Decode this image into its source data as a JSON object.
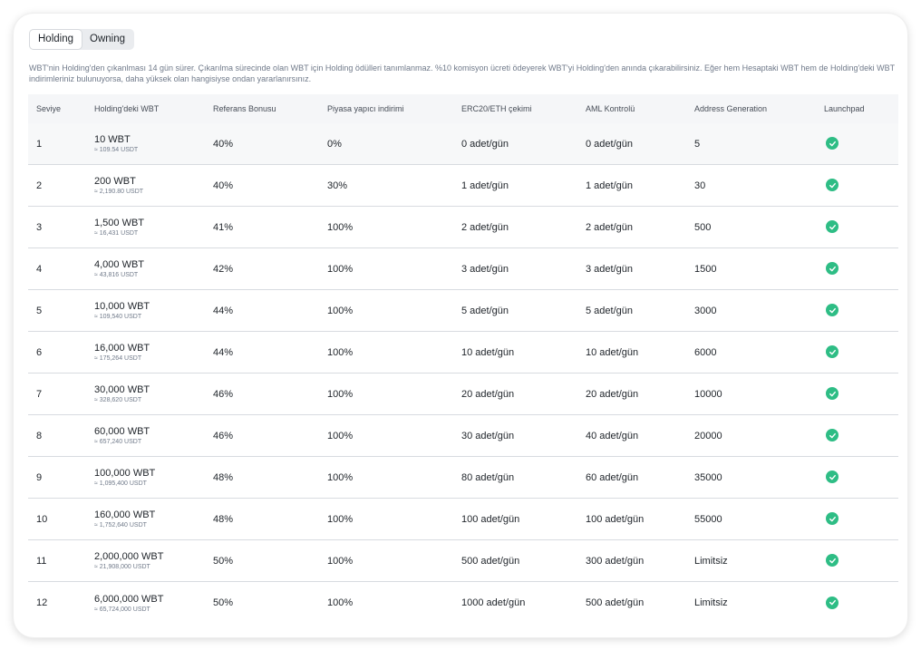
{
  "tabs": [
    {
      "label": "Holding",
      "active": true
    },
    {
      "label": "Owning",
      "active": false
    }
  ],
  "description": "WBT'nin Holding'den çıkanlması 14 gün sürer. Çıkarılma sürecinde olan WBT için Holding ödülleri tanımlanmaz. %10 komisyon ücreti ödeyerek WBT'yi Holding'den anında çıkarabilirsiniz. Eğer hem Hesaptaki WBT hem de Holding'deki WBT indirimleriniz bulunuyorsa, daha yüksek olan hangisiyse ondan yararlanırsınız.",
  "colors": {
    "accent_green": "#2ebd85"
  },
  "table": {
    "headers": [
      "Seviye",
      "Holding'deki WBT",
      "Referans Bonusu",
      "Piyasa yapıcı indirimi",
      "ERC20/ETH çekimi",
      "AML Kontrolü",
      "Address Generation",
      "Launchpad"
    ],
    "launchpad_icon": "check-circle-icon",
    "rows": [
      {
        "level": "1",
        "wbt": "10 WBT",
        "usdt": "≈ 109.54 USDT",
        "referral": "40%",
        "maker": "0%",
        "erc20": "0 adet/gün",
        "aml": "0 adet/gün",
        "address": "5",
        "launchpad": true
      },
      {
        "level": "2",
        "wbt": "200 WBT",
        "usdt": "≈ 2,190.80 USDT",
        "referral": "40%",
        "maker": "30%",
        "erc20": "1 adet/gün",
        "aml": "1 adet/gün",
        "address": "30",
        "launchpad": true
      },
      {
        "level": "3",
        "wbt": "1,500 WBT",
        "usdt": "≈ 16,431 USDT",
        "referral": "41%",
        "maker": "100%",
        "erc20": "2 adet/gün",
        "aml": "2 adet/gün",
        "address": "500",
        "launchpad": true
      },
      {
        "level": "4",
        "wbt": "4,000 WBT",
        "usdt": "≈ 43,816 USDT",
        "referral": "42%",
        "maker": "100%",
        "erc20": "3 adet/gün",
        "aml": "3 adet/gün",
        "address": "1500",
        "launchpad": true
      },
      {
        "level": "5",
        "wbt": "10,000 WBT",
        "usdt": "≈ 109,540 USDT",
        "referral": "44%",
        "maker": "100%",
        "erc20": "5 adet/gün",
        "aml": "5 adet/gün",
        "address": "3000",
        "launchpad": true
      },
      {
        "level": "6",
        "wbt": "16,000 WBT",
        "usdt": "≈ 175,264 USDT",
        "referral": "44%",
        "maker": "100%",
        "erc20": "10 adet/gün",
        "aml": "10 adet/gün",
        "address": "6000",
        "launchpad": true
      },
      {
        "level": "7",
        "wbt": "30,000 WBT",
        "usdt": "≈ 328,620 USDT",
        "referral": "46%",
        "maker": "100%",
        "erc20": "20 adet/gün",
        "aml": "20 adet/gün",
        "address": "10000",
        "launchpad": true
      },
      {
        "level": "8",
        "wbt": "60,000 WBT",
        "usdt": "≈ 657,240 USDT",
        "referral": "46%",
        "maker": "100%",
        "erc20": "30 adet/gün",
        "aml": "40 adet/gün",
        "address": "20000",
        "launchpad": true
      },
      {
        "level": "9",
        "wbt": "100,000 WBT",
        "usdt": "≈ 1,095,400 USDT",
        "referral": "48%",
        "maker": "100%",
        "erc20": "80 adet/gün",
        "aml": "60 adet/gün",
        "address": "35000",
        "launchpad": true
      },
      {
        "level": "10",
        "wbt": "160,000 WBT",
        "usdt": "≈ 1,752,640 USDT",
        "referral": "48%",
        "maker": "100%",
        "erc20": "100 adet/gün",
        "aml": "100 adet/gün",
        "address": "55000",
        "launchpad": true
      },
      {
        "level": "11",
        "wbt": "2,000,000 WBT",
        "usdt": "≈ 21,908,000 USDT",
        "referral": "50%",
        "maker": "100%",
        "erc20": "500 adet/gün",
        "aml": "300 adet/gün",
        "address": "Limitsiz",
        "launchpad": true
      },
      {
        "level": "12",
        "wbt": "6,000,000 WBT",
        "usdt": "≈ 65,724,000 USDT",
        "referral": "50%",
        "maker": "100%",
        "erc20": "1000 adet/gün",
        "aml": "500 adet/gün",
        "address": "Limitsiz",
        "launchpad": true
      }
    ]
  }
}
